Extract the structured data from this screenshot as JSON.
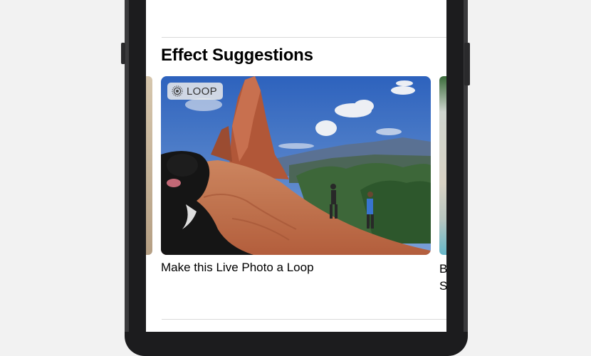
{
  "section": {
    "title": "Effect Suggestions"
  },
  "card": {
    "badge_label": "LOOP",
    "caption": "Make this Live Photo a Loop"
  },
  "next_card": {
    "caption_line1": "B",
    "caption_line2": "S"
  },
  "icons": {
    "badge": "live-photo-loop-icon"
  },
  "colors": {
    "sky": "#3a78d0",
    "rock": "#c56a45",
    "phone_frame": "#1c1c1e"
  }
}
